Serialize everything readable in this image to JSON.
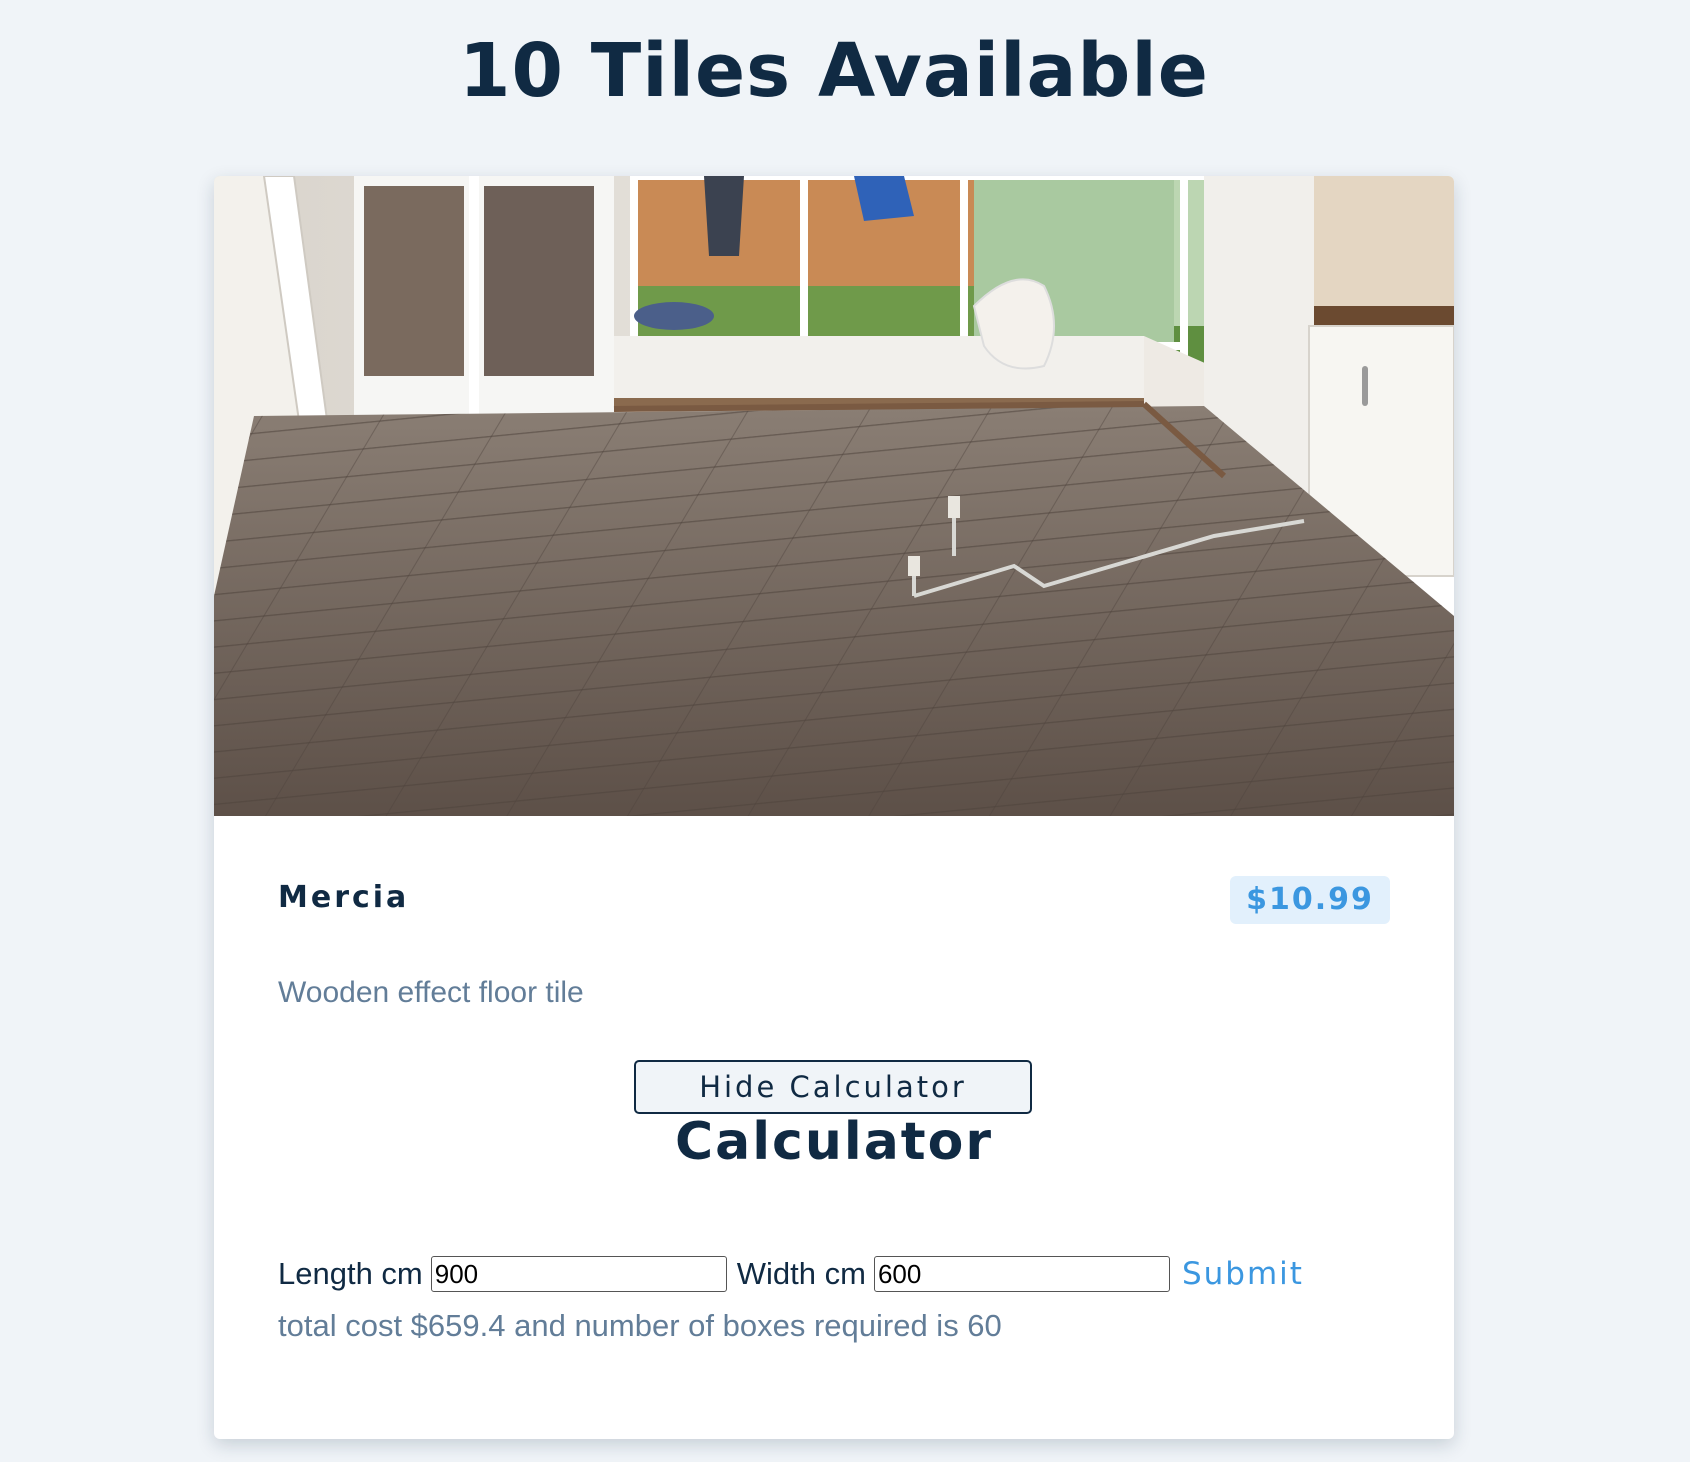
{
  "page": {
    "title": "10 Tiles Available"
  },
  "product": {
    "name": "Mercia",
    "price": "$10.99",
    "description": "Wooden effect floor tile",
    "toggle_label": "Hide Calculator"
  },
  "calculator": {
    "title": "Calculator",
    "length_label": "Length cm",
    "length_value": "900",
    "width_label": "Width cm",
    "width_value": "600",
    "submit_label": "Submit",
    "result": "total cost $659.4 and number of boxes required is 60"
  },
  "colors": {
    "page_background": "#f0f4f8",
    "heading": "#102a43",
    "accent": "#3b97e0",
    "muted_text": "#627d98",
    "badge_background": "#e2f0fc"
  }
}
